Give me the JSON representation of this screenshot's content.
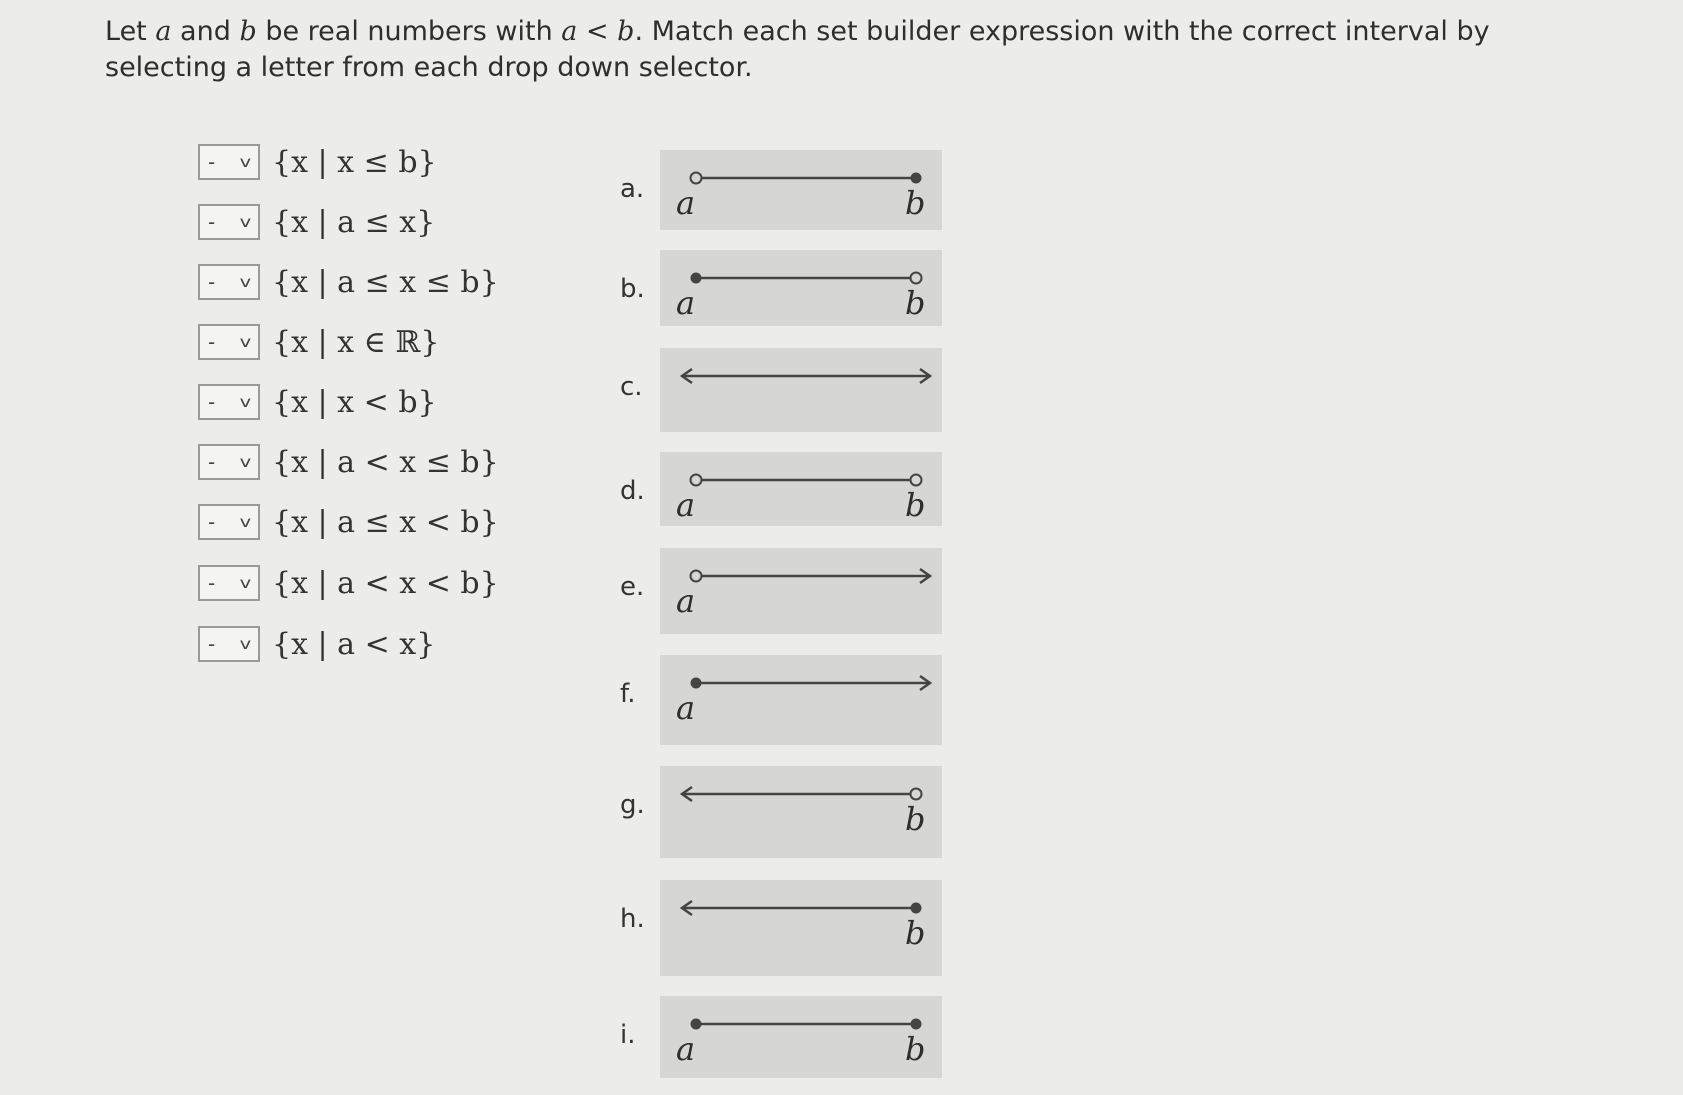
{
  "prompt": {
    "t1": "Let ",
    "v1": "a",
    "t2": " and ",
    "v2": "b",
    "t3": " be real numbers with ",
    "v3": "a < b",
    "t4": ". Match each set builder expression with the correct interval by selecting a letter from each drop down selector."
  },
  "selector_default": "-",
  "expressions": [
    "{x | x ≤ b}",
    "{x | a ≤ x}",
    "{x | a ≤ x ≤ b}",
    "{x | x ∈ ℝ}",
    "{x | x < b}",
    "{x | a < x ≤ b}",
    "{x | a ≤ x < b}",
    "{x | a < x < b}",
    "{x | a < x}"
  ],
  "options": [
    {
      "label": "a.",
      "left_end": "open",
      "right_end": "closed",
      "left_text": "a",
      "right_text": "b"
    },
    {
      "label": "b.",
      "left_end": "closed",
      "right_end": "open",
      "left_text": "a",
      "right_text": "b"
    },
    {
      "label": "c.",
      "left_end": "arrow",
      "right_end": "arrow",
      "left_text": "",
      "right_text": ""
    },
    {
      "label": "d.",
      "left_end": "open",
      "right_end": "open",
      "left_text": "a",
      "right_text": "b"
    },
    {
      "label": "e.",
      "left_end": "open",
      "right_end": "arrow",
      "left_text": "a",
      "right_text": ""
    },
    {
      "label": "f.",
      "left_end": "closed",
      "right_end": "arrow",
      "left_text": "a",
      "right_text": ""
    },
    {
      "label": "g.",
      "left_end": "arrow",
      "right_end": "open",
      "left_text": "",
      "right_text": "b"
    },
    {
      "label": "h.",
      "left_end": "arrow",
      "right_end": "closed",
      "left_text": "",
      "right_text": "b"
    },
    {
      "label": "i.",
      "left_end": "closed",
      "right_end": "closed",
      "left_text": "a",
      "right_text": "b"
    }
  ],
  "colors": {
    "panel": "#d6d6d4",
    "line": "#444444",
    "background": "#ececea"
  }
}
